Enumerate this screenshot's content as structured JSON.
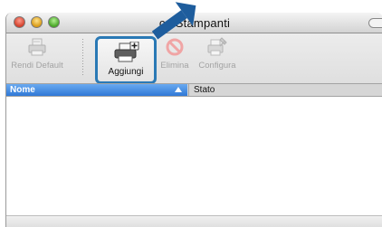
{
  "window": {
    "title": "co Stampanti"
  },
  "toolbar": {
    "rendi_default": "Rendi Default",
    "aggiungi": "Aggiungi",
    "elimina": "Elimina",
    "configura": "Configura"
  },
  "list": {
    "col_nome": "Nome",
    "col_stato": "Stato",
    "rows": []
  },
  "icons": {
    "highlight_color": "#2a79b5",
    "arrow_color": "#1e5d9d"
  }
}
